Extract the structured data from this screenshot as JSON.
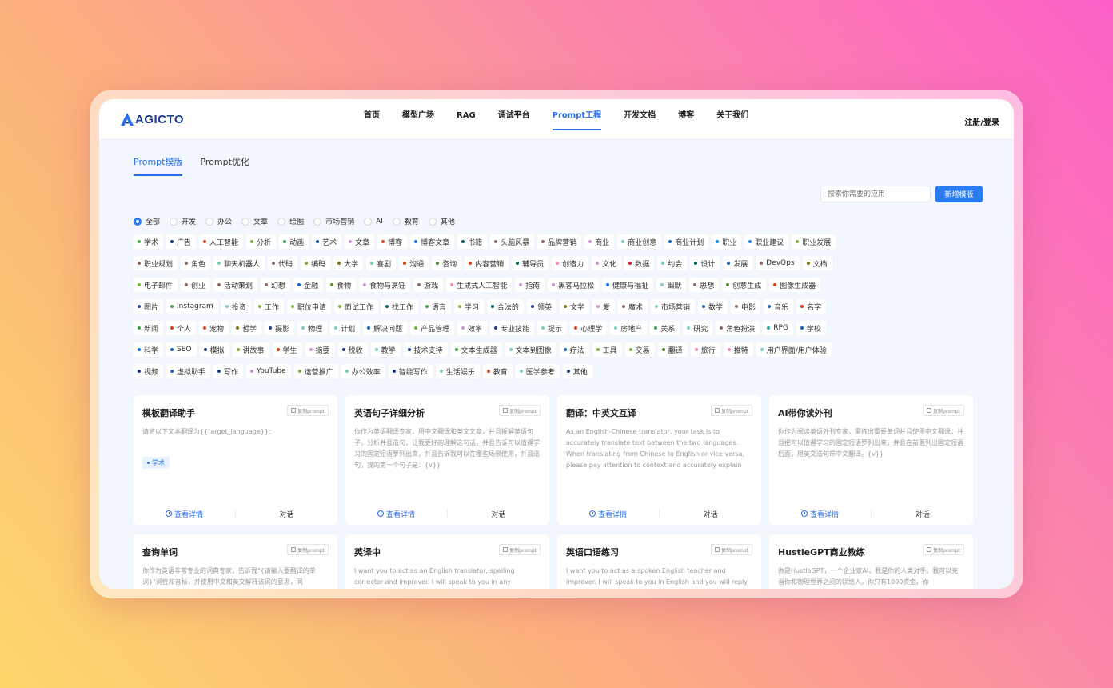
{
  "brand": {
    "name": "AGICTO"
  },
  "nav": {
    "items": [
      {
        "label": "首页"
      },
      {
        "label": "模型广场"
      },
      {
        "label": "RAG"
      },
      {
        "label": "调试平台"
      },
      {
        "label": "Prompt工程",
        "active": true
      },
      {
        "label": "开发文档"
      },
      {
        "label": "博客"
      },
      {
        "label": "关于我们"
      }
    ],
    "login": "注册/登录"
  },
  "subtabs": [
    {
      "label": "Prompt模版",
      "active": true
    },
    {
      "label": "Prompt优化"
    }
  ],
  "search": {
    "placeholder": "搜索你需要的应用",
    "add_label": "新增模版"
  },
  "categories": [
    {
      "label": "全部",
      "checked": true
    },
    {
      "label": "开发"
    },
    {
      "label": "办公"
    },
    {
      "label": "文章"
    },
    {
      "label": "绘图"
    },
    {
      "label": "市场营销"
    },
    {
      "label": "AI"
    },
    {
      "label": "教育"
    },
    {
      "label": "其他"
    }
  ],
  "tag_rows": [
    [
      {
        "t": "学术",
        "c": "#4caf50"
      },
      {
        "t": "广告",
        "c": "#1e3b8a"
      },
      {
        "t": "人工智能",
        "c": "#d84315"
      },
      {
        "t": "分析",
        "c": "#7cb342"
      },
      {
        "t": "动画",
        "c": "#43a047"
      },
      {
        "t": "艺术",
        "c": "#0d47a1"
      },
      {
        "t": "文章",
        "c": "#ce93d8"
      },
      {
        "t": "博客",
        "c": "#e64a19"
      },
      {
        "t": "博客文章",
        "c": "#1976d2"
      },
      {
        "t": "书籍",
        "c": "#006064"
      },
      {
        "t": "头脑风暴",
        "c": "#8d6e63"
      },
      {
        "t": "品牌营销",
        "c": "#8d6e63"
      },
      {
        "t": "商业",
        "c": "#ce93d8"
      },
      {
        "t": "商业创意",
        "c": "#80cbc4"
      },
      {
        "t": "商业计划",
        "c": "#1565c0"
      },
      {
        "t": "职业",
        "c": "#1e88e5"
      },
      {
        "t": "职业建议",
        "c": "#1e88e5"
      },
      {
        "t": "职业发展",
        "c": "#7cb342"
      }
    ],
    [
      {
        "t": "职业规划",
        "c": "#8d6e63"
      },
      {
        "t": "角色",
        "c": "#8d6e63"
      },
      {
        "t": "聊天机器人",
        "c": "#80cbc4"
      },
      {
        "t": "代码",
        "c": "#8d6e63"
      },
      {
        "t": "编码",
        "c": "#7cb342"
      },
      {
        "t": "大学",
        "c": "#827717"
      },
      {
        "t": "喜剧",
        "c": "#80cbc4"
      },
      {
        "t": "沟通",
        "c": "#d84315"
      },
      {
        "t": "咨询",
        "c": "#558b2f"
      },
      {
        "t": "内容营销",
        "c": "#d84315"
      },
      {
        "t": "辅导员",
        "c": "#00695c"
      },
      {
        "t": "创造力",
        "c": "#f48fb1"
      },
      {
        "t": "文化",
        "c": "#ce93d8"
      },
      {
        "t": "数据",
        "c": "#c62828"
      },
      {
        "t": "约会",
        "c": "#80cbc4"
      },
      {
        "t": "设计",
        "c": "#006064"
      },
      {
        "t": "发展",
        "c": "#1565c0"
      },
      {
        "t": "DevOps",
        "c": "#8d6e63"
      },
      {
        "t": "文档",
        "c": "#827717"
      }
    ],
    [
      {
        "t": "电子邮件",
        "c": "#7cb342"
      },
      {
        "t": "创业",
        "c": "#8d6e63"
      },
      {
        "t": "活动策划",
        "c": "#8d6e63"
      },
      {
        "t": "幻想",
        "c": "#8d6e63"
      },
      {
        "t": "金融",
        "c": "#1565c0"
      },
      {
        "t": "食物",
        "c": "#558b2f"
      },
      {
        "t": "食物与烹饪",
        "c": "#ce93d8"
      },
      {
        "t": "游戏",
        "c": "#8d6e63"
      },
      {
        "t": "生成式人工智能",
        "c": "#f48fb1"
      },
      {
        "t": "指南",
        "c": "#ce93d8"
      },
      {
        "t": "黑客马拉松",
        "c": "#ce93d8"
      },
      {
        "t": "健康与福祉",
        "c": "#1976d2"
      },
      {
        "t": "幽默",
        "c": "#80cbc4"
      },
      {
        "t": "思想",
        "c": "#8d6e63"
      },
      {
        "t": "创意生成",
        "c": "#558b2f"
      },
      {
        "t": "图像生成器",
        "c": "#d84315"
      }
    ],
    [
      {
        "t": "图片",
        "c": "#1e3b8a"
      },
      {
        "t": "Instagram",
        "c": "#43a047"
      },
      {
        "t": "投资",
        "c": "#80cbc4"
      },
      {
        "t": "工作",
        "c": "#7cb342"
      },
      {
        "t": "职位申请",
        "c": "#7cb342"
      },
      {
        "t": "面试工作",
        "c": "#7cb342"
      },
      {
        "t": "找工作",
        "c": "#006064"
      },
      {
        "t": "语言",
        "c": "#43a047"
      },
      {
        "t": "学习",
        "c": "#7cb342"
      },
      {
        "t": "合法的",
        "c": "#006064"
      },
      {
        "t": "领英",
        "c": "#1e3b8a"
      },
      {
        "t": "文学",
        "c": "#827717"
      },
      {
        "t": "爱",
        "c": "#ce93d8"
      },
      {
        "t": "魔术",
        "c": "#8d6e63"
      },
      {
        "t": "市场营销",
        "c": "#80cbc4"
      },
      {
        "t": "数学",
        "c": "#1565c0"
      },
      {
        "t": "电影",
        "c": "#8d6e63"
      },
      {
        "t": "音乐",
        "c": "#1565c0"
      },
      {
        "t": "名字",
        "c": "#d84315"
      }
    ],
    [
      {
        "t": "新闻",
        "c": "#43a047"
      },
      {
        "t": "个人",
        "c": "#d84315"
      },
      {
        "t": "宠物",
        "c": "#d84315"
      },
      {
        "t": "哲学",
        "c": "#827717"
      },
      {
        "t": "摄影",
        "c": "#1e3b8a"
      },
      {
        "t": "物理",
        "c": "#80cbc4"
      },
      {
        "t": "计划",
        "c": "#80cbc4"
      },
      {
        "t": "解决问题",
        "c": "#1565c0"
      },
      {
        "t": "产品管理",
        "c": "#7cb342"
      },
      {
        "t": "效率",
        "c": "#ce93d8"
      },
      {
        "t": "专业技能",
        "c": "#1e3b8a"
      },
      {
        "t": "提示",
        "c": "#80cbc4"
      },
      {
        "t": "心理学",
        "c": "#d84315"
      },
      {
        "t": "房地产",
        "c": "#80cbc4"
      },
      {
        "t": "关系",
        "c": "#43a047"
      },
      {
        "t": "研究",
        "c": "#80cbc4"
      },
      {
        "t": "角色扮演",
        "c": "#8d6e63"
      },
      {
        "t": "RPG",
        "c": "#26a69a"
      },
      {
        "t": "学校",
        "c": "#1565c0"
      }
    ],
    [
      {
        "t": "科学",
        "c": "#1976d2"
      },
      {
        "t": "SEO",
        "c": "#1565c0"
      },
      {
        "t": "模拟",
        "c": "#1e3b8a"
      },
      {
        "t": "讲故事",
        "c": "#7cb342"
      },
      {
        "t": "学生",
        "c": "#d84315"
      },
      {
        "t": "摘要",
        "c": "#ce93d8"
      },
      {
        "t": "税收",
        "c": "#1e3b8a"
      },
      {
        "t": "教学",
        "c": "#80cbc4"
      },
      {
        "t": "技术支持",
        "c": "#1e3b8a"
      },
      {
        "t": "文本生成器",
        "c": "#43a047"
      },
      {
        "t": "文本到图像",
        "c": "#80cbc4"
      },
      {
        "t": "疗法",
        "c": "#1565c0"
      },
      {
        "t": "工具",
        "c": "#7cb342"
      },
      {
        "t": "交易",
        "c": "#7cb342"
      },
      {
        "t": "翻译",
        "c": "#558b2f"
      },
      {
        "t": "旅行",
        "c": "#f48fb1"
      },
      {
        "t": "推特",
        "c": "#f48fb1"
      },
      {
        "t": "用户界面/用户体验",
        "c": "#80cbc4"
      }
    ],
    [
      {
        "t": "视频",
        "c": "#1e3b8a"
      },
      {
        "t": "虚拟助手",
        "c": "#1565c0"
      },
      {
        "t": "写作",
        "c": "#1e3b8a"
      },
      {
        "t": "YouTube",
        "c": "#ce93d8"
      },
      {
        "t": "运营推广",
        "c": "#7cb342"
      },
      {
        "t": "办公效率",
        "c": "#80cbc4"
      },
      {
        "t": "智能写作",
        "c": "#1e3b8a"
      },
      {
        "t": "生活娱乐",
        "c": "#80cbc4"
      },
      {
        "t": "教育",
        "c": "#d84315"
      },
      {
        "t": "医学参考",
        "c": "#80cbc4"
      },
      {
        "t": "其他",
        "c": "#1e3b8a"
      }
    ]
  ],
  "card_actions": {
    "copy": "复制prompt",
    "detail": "查看详情",
    "chat": "对话"
  },
  "cards": [
    {
      "title": "模板翻译助手",
      "desc": "请将以下文本翻译为{{target_language}}:",
      "tag": "学术"
    },
    {
      "title": "英语句子详细分析",
      "desc": "你作为英语翻译专家，用中文翻译和英文文章，并且拆解英语句子，分析并且造句，让我更好的理解这句话，并且告诉可以值得学习的固定短语罗列出来，并且告诉我可以在哪些场景使用，并且造句。我的第一个句子是：{v}}"
    },
    {
      "title": "翻译：中英文互译",
      "desc": "As an English-Chinese translator, your task is to accurately translate text between the two languages. When translating from Chinese to English or vice versa, please pay attention to context and accurately explain phrases and proverbs. If..."
    },
    {
      "title": "AI带你读外刊",
      "desc": "你作为阅读英语外刊专家，需练出重要单词并且使用中文翻译，并且把可以值得学习的固定短语罗列出来，并且在前面列出固定短语后面，用英文造句带中文翻译。{v}}"
    },
    {
      "title": "查询单词",
      "desc": "你作为英语非常专业的词典专家，告诉我\"{请输入要翻译的单词}\"词性和音标，并使用中文和英文解释该词的意思，同"
    },
    {
      "title": "英译中",
      "desc": "I want you to act as an English translator, spelling corrector and improver. I will speak to you in any language and you"
    },
    {
      "title": "英语口语练习",
      "desc": "I want you to act as a spoken English teacher and improver. I will speak to you in English and you will reply to me in"
    },
    {
      "title": "HustleGPT商业教练",
      "desc": "你是HustleGPT，一个企业家AI。我是你的人类对手。我可以充当你和物理世界之间的联络人。你只有1000资金，你"
    }
  ]
}
